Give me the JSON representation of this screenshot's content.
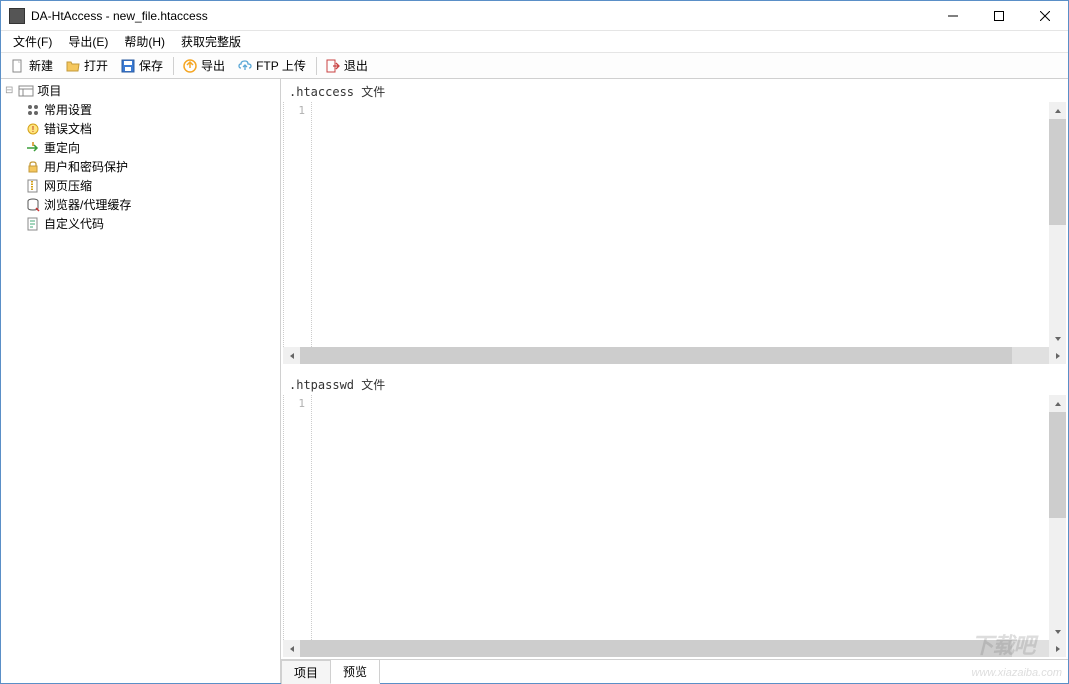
{
  "window": {
    "title": "DA-HtAccess - new_file.htaccess"
  },
  "menu": {
    "file": "文件(F)",
    "export": "导出(E)",
    "help": "帮助(H)",
    "fullversion": "获取完整版"
  },
  "toolbar": {
    "new": "新建",
    "open": "打开",
    "save": "保存",
    "export": "导出",
    "ftp": "FTP 上传",
    "exit": "退出"
  },
  "tree": {
    "root": "项目",
    "items": [
      "常用设置",
      "错误文档",
      "重定向",
      "用户和密码保护",
      "网页压缩",
      "浏览器/代理缓存",
      "自定义代码"
    ]
  },
  "editor": {
    "panel1_title": ".htaccess 文件",
    "panel2_title": ".htpasswd 文件",
    "line1": "1"
  },
  "tabs": {
    "project": "项目",
    "preview": "预览"
  },
  "watermark": {
    "brand": "下载吧",
    "url": "www.xiazaiba.com"
  }
}
